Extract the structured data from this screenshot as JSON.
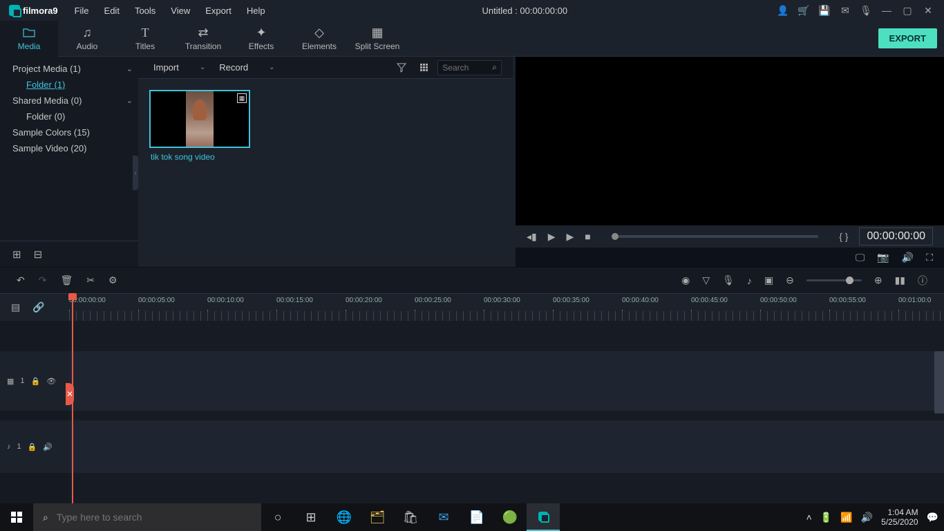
{
  "app": {
    "name": "filmora",
    "ver": "9"
  },
  "title": "Untitled : 00:00:00:00",
  "menus": [
    "File",
    "Edit",
    "Tools",
    "View",
    "Export",
    "Help"
  ],
  "tabs": [
    {
      "id": "media",
      "label": "Media",
      "icon": "folder"
    },
    {
      "id": "audio",
      "label": "Audio",
      "icon": "music"
    },
    {
      "id": "titles",
      "label": "Titles",
      "icon": "text"
    },
    {
      "id": "transition",
      "label": "Transition",
      "icon": "transition"
    },
    {
      "id": "effects",
      "label": "Effects",
      "icon": "sparkle"
    },
    {
      "id": "elements",
      "label": "Elements",
      "icon": "shapes"
    },
    {
      "id": "splitscreen",
      "label": "Split Screen",
      "icon": "grid"
    }
  ],
  "export_label": "EXPORT",
  "tree": {
    "project": "Project Media (1)",
    "folder1": "Folder (1)",
    "shared": "Shared Media (0)",
    "folder0": "Folder (0)",
    "colors": "Sample Colors (15)",
    "videos": "Sample Video (20)"
  },
  "center_tb": {
    "import": "Import",
    "record": "Record",
    "search_ph": "Search"
  },
  "clip": {
    "name": "tik tok song video"
  },
  "preview_time": "00:00:00:00",
  "ruler": [
    "00:00:00:00",
    "00:00:05:00",
    "00:00:10:00",
    "00:00:15:00",
    "00:00:20:00",
    "00:00:25:00",
    "00:00:30:00",
    "00:00:35:00",
    "00:00:40:00",
    "00:00:45:00",
    "00:00:50:00",
    "00:00:55:00",
    "00:01:00:0"
  ],
  "tracks": {
    "video": "1",
    "audio": "1"
  },
  "taskbar": {
    "search_ph": "Type here to search",
    "time": "1:04 AM",
    "date": "5/25/2020"
  }
}
